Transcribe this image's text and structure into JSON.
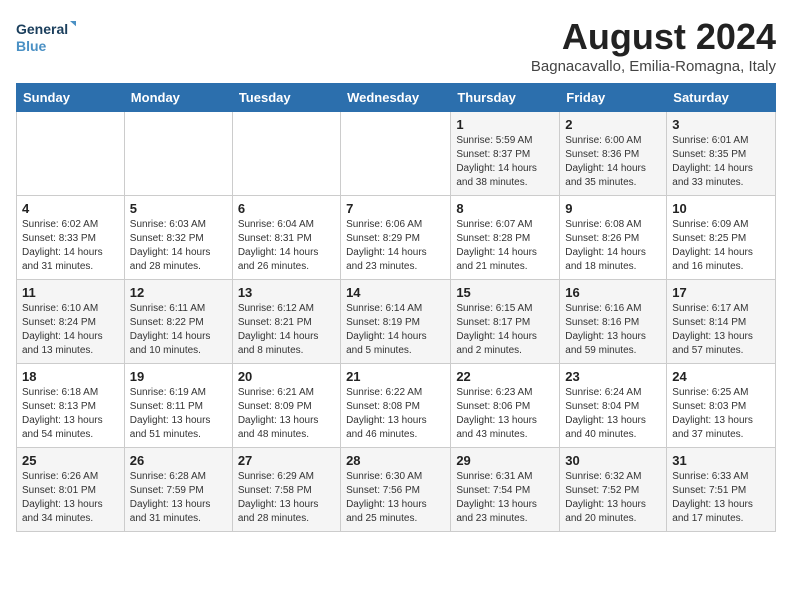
{
  "logo": {
    "line1": "General",
    "line2": "Blue"
  },
  "title": "August 2024",
  "location": "Bagnacavallo, Emilia-Romagna, Italy",
  "weekdays": [
    "Sunday",
    "Monday",
    "Tuesday",
    "Wednesday",
    "Thursday",
    "Friday",
    "Saturday"
  ],
  "weeks": [
    [
      {
        "day": "",
        "info": ""
      },
      {
        "day": "",
        "info": ""
      },
      {
        "day": "",
        "info": ""
      },
      {
        "day": "",
        "info": ""
      },
      {
        "day": "1",
        "info": "Sunrise: 5:59 AM\nSunset: 8:37 PM\nDaylight: 14 hours\nand 38 minutes."
      },
      {
        "day": "2",
        "info": "Sunrise: 6:00 AM\nSunset: 8:36 PM\nDaylight: 14 hours\nand 35 minutes."
      },
      {
        "day": "3",
        "info": "Sunrise: 6:01 AM\nSunset: 8:35 PM\nDaylight: 14 hours\nand 33 minutes."
      }
    ],
    [
      {
        "day": "4",
        "info": "Sunrise: 6:02 AM\nSunset: 8:33 PM\nDaylight: 14 hours\nand 31 minutes."
      },
      {
        "day": "5",
        "info": "Sunrise: 6:03 AM\nSunset: 8:32 PM\nDaylight: 14 hours\nand 28 minutes."
      },
      {
        "day": "6",
        "info": "Sunrise: 6:04 AM\nSunset: 8:31 PM\nDaylight: 14 hours\nand 26 minutes."
      },
      {
        "day": "7",
        "info": "Sunrise: 6:06 AM\nSunset: 8:29 PM\nDaylight: 14 hours\nand 23 minutes."
      },
      {
        "day": "8",
        "info": "Sunrise: 6:07 AM\nSunset: 8:28 PM\nDaylight: 14 hours\nand 21 minutes."
      },
      {
        "day": "9",
        "info": "Sunrise: 6:08 AM\nSunset: 8:26 PM\nDaylight: 14 hours\nand 18 minutes."
      },
      {
        "day": "10",
        "info": "Sunrise: 6:09 AM\nSunset: 8:25 PM\nDaylight: 14 hours\nand 16 minutes."
      }
    ],
    [
      {
        "day": "11",
        "info": "Sunrise: 6:10 AM\nSunset: 8:24 PM\nDaylight: 14 hours\nand 13 minutes."
      },
      {
        "day": "12",
        "info": "Sunrise: 6:11 AM\nSunset: 8:22 PM\nDaylight: 14 hours\nand 10 minutes."
      },
      {
        "day": "13",
        "info": "Sunrise: 6:12 AM\nSunset: 8:21 PM\nDaylight: 14 hours\nand 8 minutes."
      },
      {
        "day": "14",
        "info": "Sunrise: 6:14 AM\nSunset: 8:19 PM\nDaylight: 14 hours\nand 5 minutes."
      },
      {
        "day": "15",
        "info": "Sunrise: 6:15 AM\nSunset: 8:17 PM\nDaylight: 14 hours\nand 2 minutes."
      },
      {
        "day": "16",
        "info": "Sunrise: 6:16 AM\nSunset: 8:16 PM\nDaylight: 13 hours\nand 59 minutes."
      },
      {
        "day": "17",
        "info": "Sunrise: 6:17 AM\nSunset: 8:14 PM\nDaylight: 13 hours\nand 57 minutes."
      }
    ],
    [
      {
        "day": "18",
        "info": "Sunrise: 6:18 AM\nSunset: 8:13 PM\nDaylight: 13 hours\nand 54 minutes."
      },
      {
        "day": "19",
        "info": "Sunrise: 6:19 AM\nSunset: 8:11 PM\nDaylight: 13 hours\nand 51 minutes."
      },
      {
        "day": "20",
        "info": "Sunrise: 6:21 AM\nSunset: 8:09 PM\nDaylight: 13 hours\nand 48 minutes."
      },
      {
        "day": "21",
        "info": "Sunrise: 6:22 AM\nSunset: 8:08 PM\nDaylight: 13 hours\nand 46 minutes."
      },
      {
        "day": "22",
        "info": "Sunrise: 6:23 AM\nSunset: 8:06 PM\nDaylight: 13 hours\nand 43 minutes."
      },
      {
        "day": "23",
        "info": "Sunrise: 6:24 AM\nSunset: 8:04 PM\nDaylight: 13 hours\nand 40 minutes."
      },
      {
        "day": "24",
        "info": "Sunrise: 6:25 AM\nSunset: 8:03 PM\nDaylight: 13 hours\nand 37 minutes."
      }
    ],
    [
      {
        "day": "25",
        "info": "Sunrise: 6:26 AM\nSunset: 8:01 PM\nDaylight: 13 hours\nand 34 minutes."
      },
      {
        "day": "26",
        "info": "Sunrise: 6:28 AM\nSunset: 7:59 PM\nDaylight: 13 hours\nand 31 minutes."
      },
      {
        "day": "27",
        "info": "Sunrise: 6:29 AM\nSunset: 7:58 PM\nDaylight: 13 hours\nand 28 minutes."
      },
      {
        "day": "28",
        "info": "Sunrise: 6:30 AM\nSunset: 7:56 PM\nDaylight: 13 hours\nand 25 minutes."
      },
      {
        "day": "29",
        "info": "Sunrise: 6:31 AM\nSunset: 7:54 PM\nDaylight: 13 hours\nand 23 minutes."
      },
      {
        "day": "30",
        "info": "Sunrise: 6:32 AM\nSunset: 7:52 PM\nDaylight: 13 hours\nand 20 minutes."
      },
      {
        "day": "31",
        "info": "Sunrise: 6:33 AM\nSunset: 7:51 PM\nDaylight: 13 hours\nand 17 minutes."
      }
    ]
  ]
}
